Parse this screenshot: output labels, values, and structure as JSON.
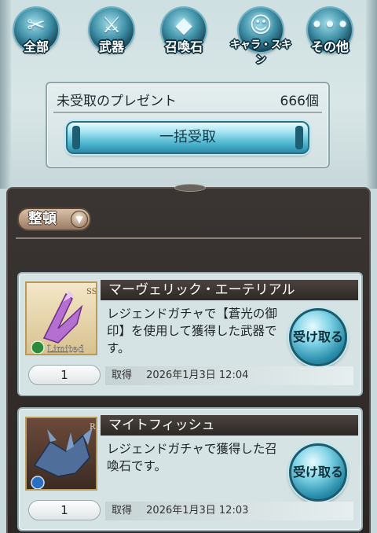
{
  "nav": {
    "categories": [
      {
        "label": "全部",
        "icon": "scissors-tag-icon"
      },
      {
        "label": "武器",
        "icon": "sword-icon"
      },
      {
        "label": "召喚石",
        "icon": "crystal-icon"
      },
      {
        "label": "キャラ・スキン",
        "icon": "character-icon"
      },
      {
        "label": "その他",
        "icon": "more-dots-icon"
      }
    ]
  },
  "summary": {
    "title": "未受取のプレゼント",
    "count": "666個",
    "receive_all_label": "一括受取"
  },
  "list": {
    "sort_label": "整頓",
    "items": [
      {
        "name": "マーヴェリック・エーテリアル",
        "description": "レジェンドガチャで【蒼光の御印】を使用して獲得した武器です。",
        "quantity": "1",
        "obtained_label": "取得",
        "obtained_date": "2026年1月3日 12:04",
        "rarity": "SSR",
        "tag": "Limited",
        "receive_label": "受け取る"
      },
      {
        "name": "マイトフィッシュ",
        "description": "レジェンドガチャで獲得した召喚石です。",
        "quantity": "1",
        "obtained_label": "取得",
        "obtained_date": "2026年1月3日 12:03",
        "rarity": "R",
        "receive_label": "受け取る"
      }
    ]
  },
  "colors": {
    "accent_blue": "#4cb5cf",
    "panel_dark": "#2b2624",
    "card_bg": "#d6e3e5"
  }
}
